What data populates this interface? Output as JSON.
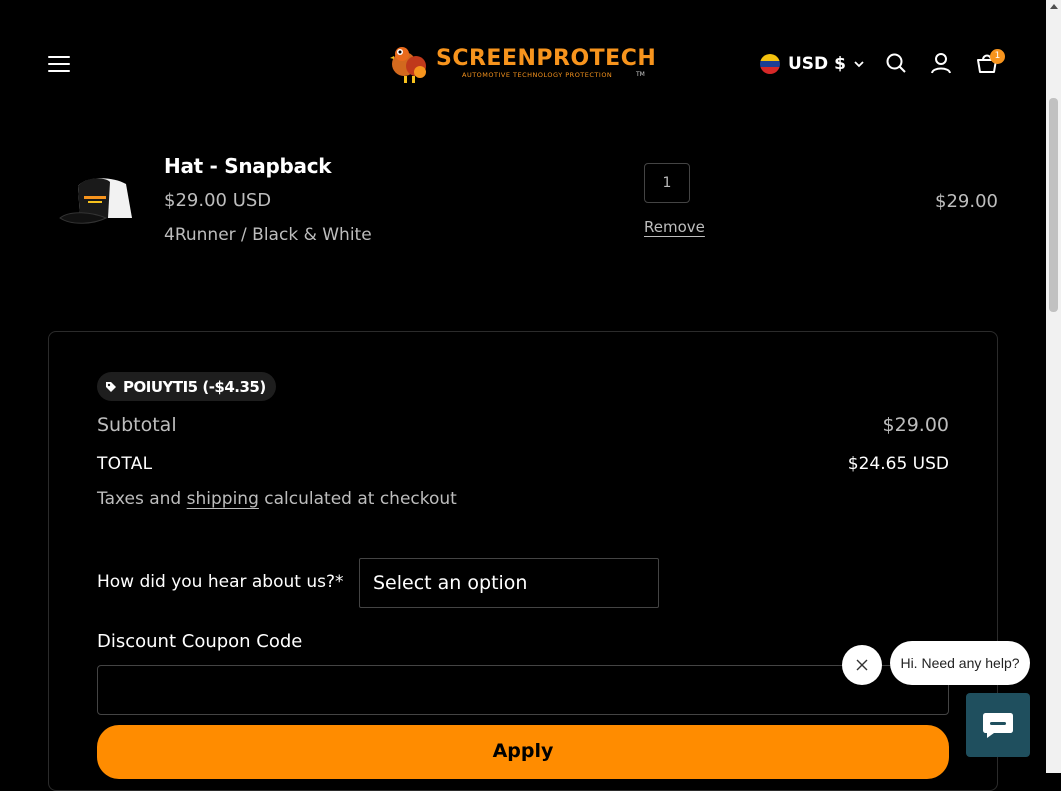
{
  "header": {
    "logo_text": "SCREENPROTECH",
    "logo_tagline": "AUTOMOTIVE TECHNOLOGY PROTECTION",
    "logo_tm": "TM",
    "currency": "USD $",
    "cart_count": "1"
  },
  "cart_item": {
    "title": "Hat - Snapback",
    "price": "$29.00 USD",
    "variant": "4Runner / Black & White",
    "quantity": "1",
    "remove_label": "Remove",
    "line_total": "$29.00"
  },
  "summary": {
    "discount_code": "POIUYTI5 (-$4.35)",
    "subtotal_label": "Subtotal",
    "subtotal_value": "$29.00",
    "total_label": "TOTAL",
    "total_value": "$24.65 USD",
    "taxes_prefix": "Taxes and ",
    "taxes_link": "shipping",
    "taxes_suffix": " calculated at checkout",
    "hear_label": "How did you hear about us?*",
    "hear_select_value": "Select an option",
    "coupon_label": "Discount Coupon Code",
    "coupon_value": "",
    "apply_label": "Apply"
  },
  "chat": {
    "bubble_text": "Hi. Need any help?"
  },
  "colors": {
    "accent": "#ff8c00",
    "logo": "#f7941d",
    "chat_button": "#1f4f5e"
  }
}
